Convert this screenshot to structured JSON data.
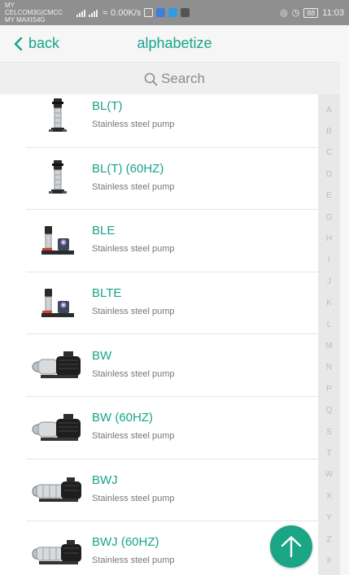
{
  "status_bar": {
    "carrier_1": "MY CELCOM3G|CMCC",
    "carrier_2": "MY MAXIS4G",
    "network_speed": "0.00K/s",
    "battery": "88",
    "time": "11:03"
  },
  "nav": {
    "back_label": "back",
    "title": "alphabetize"
  },
  "search": {
    "placeholder": "Search"
  },
  "items": [
    {
      "name": "BL(T)",
      "description": "Stainless steel pump",
      "image": "vertical-pump"
    },
    {
      "name": "BL(T) (60HZ)",
      "description": "Stainless steel pump",
      "image": "vertical-pump"
    },
    {
      "name": "BLE",
      "description": "Stainless steel pump",
      "image": "pump-with-control-box"
    },
    {
      "name": "BLTE",
      "description": "Stainless steel pump",
      "image": "pump-with-control-box"
    },
    {
      "name": "BW",
      "description": "Stainless steel pump",
      "image": "horizontal-pump"
    },
    {
      "name": "BW (60HZ)",
      "description": "Stainless steel pump",
      "image": "horizontal-pump"
    },
    {
      "name": "BWJ",
      "description": "Stainless steel pump",
      "image": "horizontal-multistage-pump"
    },
    {
      "name": "BWJ (60HZ)",
      "description": "Stainless steel pump",
      "image": "horizontal-multistage-pump"
    }
  ],
  "index_letters": [
    "A",
    "B",
    "C",
    "D",
    "E",
    "G",
    "H",
    "I",
    "J",
    "K",
    "L",
    "M",
    "N",
    "P",
    "Q",
    "S",
    "T",
    "W",
    "X",
    "Y",
    "Z",
    "#"
  ],
  "colors": {
    "accent": "#17a48a",
    "fab": "#1aa584",
    "status_bar": "#8f8f8f",
    "index_letter": "#bcbcbc"
  },
  "icons": {
    "back": "chevron-left-icon",
    "search": "search-icon",
    "fab": "arrow-up-icon"
  }
}
